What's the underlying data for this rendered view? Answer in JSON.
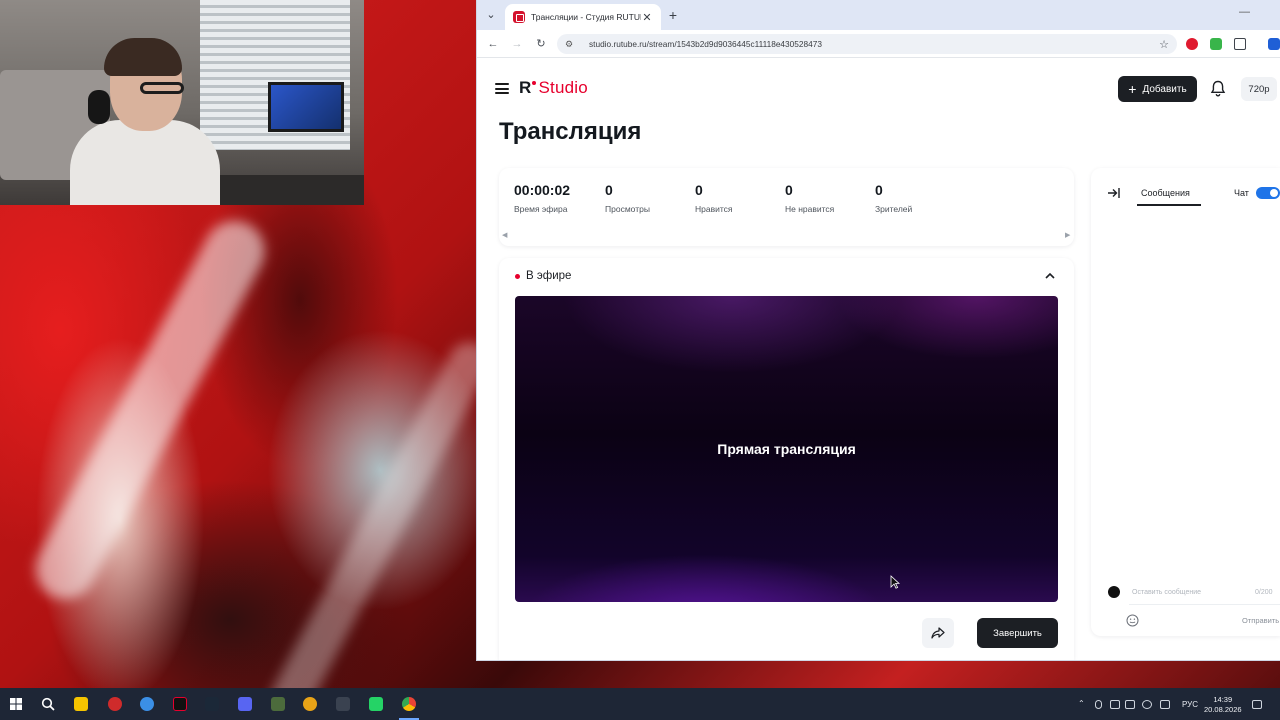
{
  "browser": {
    "tab_title": "Трансляции - Студия RUTUBE",
    "url": "studio.rutube.ru/stream/1543b2d9d9036445c11118e430528473",
    "new_tab_glyph": "+",
    "close_glyph": "✕"
  },
  "header": {
    "logo_r": "R",
    "logo_studio": "Studio",
    "add_button": "Добавить",
    "quality": "720p"
  },
  "page": {
    "title": "Трансляция"
  },
  "stats": [
    {
      "value": "00:00:02",
      "label": "Время эфира"
    },
    {
      "value": "0",
      "label": "Просмотры"
    },
    {
      "value": "0",
      "label": "Нравится"
    },
    {
      "value": "0",
      "label": "Не нравится"
    },
    {
      "value": "0",
      "label": "Зрителей"
    }
  ],
  "live": {
    "status": "В эфире",
    "player_caption": "Прямая трансляция",
    "finish_button": "Завершить"
  },
  "chat": {
    "tab_messages": "Сообщения",
    "toggle_label": "Чат",
    "toggle_on": true,
    "input_placeholder": "Оставить сообщение",
    "counter": "0/200",
    "send_label": "Отправить"
  },
  "taskbar": {
    "language": "РУС",
    "time": "14:39",
    "date": "20.08.2026"
  },
  "colors": {
    "accent_red": "#e6002d",
    "dark_button": "#1c1f24",
    "toggle_blue": "#1f74e8",
    "taskbar": "#1e2636"
  }
}
